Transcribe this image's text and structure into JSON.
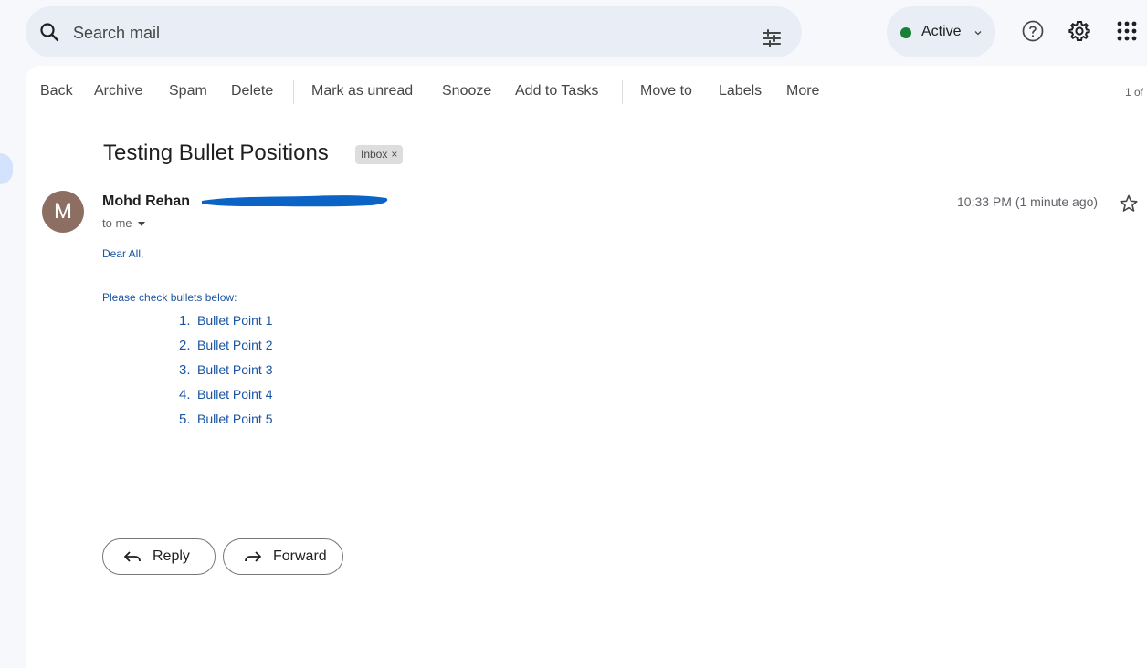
{
  "search": {
    "placeholder": "Search mail"
  },
  "status": {
    "label": "Active",
    "color": "#188038"
  },
  "toolbar": {
    "back": "Back",
    "archive": "Archive",
    "spam": "Spam",
    "delete": "Delete",
    "mark_unread": "Mark as unread",
    "snooze": "Snooze",
    "add_tasks": "Add to Tasks",
    "move_to": "Move to",
    "labels": "Labels",
    "more": "More",
    "pager": "1 of"
  },
  "email": {
    "subject": "Testing Bullet Positions",
    "label": "Inbox",
    "sender_initial": "M",
    "sender_name": "Mohd Rehan",
    "to": "to me",
    "timestamp": "10:33 PM (1 minute ago)",
    "greeting": "Dear All,",
    "intro": "Please check bullets below:",
    "bullets": [
      {
        "num": "1.",
        "text": "Bullet Point 1"
      },
      {
        "num": "2.",
        "text": "Bullet Point 2"
      },
      {
        "num": "3.",
        "text": "Bullet Point 3"
      },
      {
        "num": "4.",
        "text": "Bullet Point 4"
      },
      {
        "num": "5.",
        "text": "Bullet Point 5"
      }
    ]
  },
  "actions": {
    "reply": "Reply",
    "forward": "Forward"
  },
  "icons": {
    "search": "search-icon",
    "tune": "tune-icon",
    "help": "help-icon",
    "settings": "settings-icon",
    "apps": "apps-grid-icon",
    "star": "star-icon",
    "reply": "reply-icon",
    "forward": "forward-icon"
  },
  "colors": {
    "accent": "#0b57d0",
    "body_text": "#1a55a3",
    "redaction": "#0b63c6"
  }
}
